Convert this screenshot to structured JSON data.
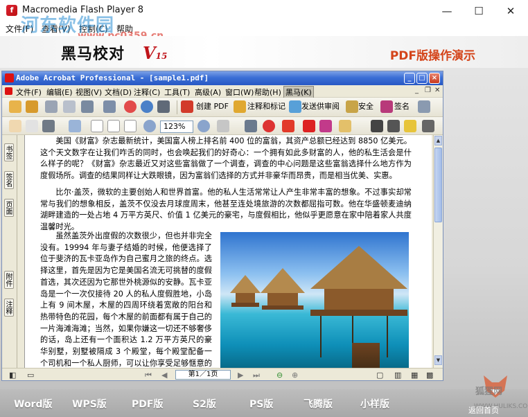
{
  "window": {
    "title": "Macromedia Flash Player 8",
    "minimize": "—",
    "maximize": "☐",
    "close": "✕"
  },
  "flash_menu": {
    "file": "文件(F)",
    "view": "查看(V)",
    "control": "控制(C)",
    "help": "帮助"
  },
  "watermark": {
    "text": "河东软件园",
    "url": "www.pc0359.cn"
  },
  "banner": {
    "logo": "黑马校对",
    "version_mark": "V",
    "version_num": "15",
    "demo_title": "PDF版操作演示"
  },
  "acrobat": {
    "title": "Adobe Acrobat Professional - [sample1.pdf]",
    "menu": [
      "文件(F)",
      "编辑(E)",
      "视图(V)",
      "文档(D)",
      "注释(C)",
      "工具(T)",
      "高级(A)",
      "窗口(W)",
      "帮助(H)",
      "黑马(K)"
    ],
    "toolbar1": {
      "create_pdf": "创建 PDF",
      "comment_markup": "注释和标记",
      "send_review": "发送供审阅",
      "security": "安全",
      "sign": "签名"
    },
    "zoom": "123%",
    "side_tabs": [
      "书签",
      "签名",
      "页面",
      "附件",
      "注释"
    ],
    "page_indicator": "第1／1页"
  },
  "document": {
    "para1": "美国《财富》杂志最新统计，美国富人榜上排名前 400 位的富翁，其资产总额已经达到 8850 亿美元。这个天文数字在让我们咋舌的同时，也会唤起我们的好奇心：一个拥有如此多财富的人，他的私生活会是什么样子的呢？《财富》杂志最近又对这些富翁做了一个调查，调查的中心问题是这些富翁选择什么地方作为度假场所。调查的结果同样让大跌眼镜，因为富翁们选择的方式并非豪华而昂贵，而是相当优美、实惠。",
    "para2": "比尔·盖茨，微软的主要创始人和世界首富。他的私人生活常常让人产生非常丰富的想象。不过事实却常常与我们的想象相反，盖茨不仅没去月球度周末，他甚至连处境旅游的次数都屈指可数。他在华盛顿麦迪纳湖畔建造的一处占地 4 万平方英尺、价值 1 亿美元的豪宅，与度假相比，他似乎更愿意在家中陪着家人共度温馨时光。",
    "para3": "虽然盖茨外出度假的次数很少，但也并非完全没有。19994 年与妻子结婚的时候，他便选择了位于斐济的瓦卡亚岛作为自己蜜月之旅的终点。选择这里，首先是因为它是美国名流无可挑替的度假首选，其次还因为它那世外桃源似的安静。瓦卡亚岛是一个一次仅接待 20 人的私人度假胜地，小岛上有 9 间木屋，木屋的四周环绕着宽敞的阳台和热带特色的花园，每个木屋的前面都有属于自己的一片海滩海滩；当然，如果你嫌这一切还不够奢侈的话，岛上还有一个面积达 1.2 万平方英尺的豪华别墅，别墅被隔成 3 个殿堂，每个殿堂配备一个司机和一个私人厨师，可以让你享受足够惬意的生活。"
  },
  "bottom_nav": [
    "Word版",
    "WPS版",
    "PDF版",
    "S2版",
    "PS版",
    "飞腾版",
    "小样版"
  ],
  "footer": {
    "brand": "狐狸网",
    "url": "WWW.HULIKS.COM",
    "back_home": "返回首页"
  },
  "colors": {
    "acrobat_title_blue": "#2858c4",
    "demo_title_orange": "#d4441a",
    "logo_red": "#c0141a"
  }
}
